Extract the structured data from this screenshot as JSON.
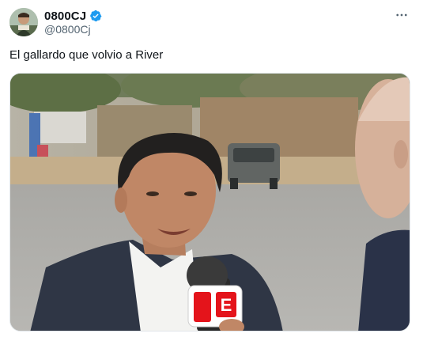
{
  "tweet": {
    "display_name": "0800CJ",
    "handle": "@0800Cj",
    "text": "El gallardo que volvio a River",
    "verified": true,
    "more_icon": "more-horizontal-icon",
    "verified_icon": "verified-badge-icon",
    "media": {
      "microphone_logo": "E",
      "alt": "photo"
    }
  },
  "colors": {
    "verified": "#1d9bf0",
    "text_primary": "#0f1419",
    "text_secondary": "#536471",
    "espn_red": "#e4141b"
  }
}
